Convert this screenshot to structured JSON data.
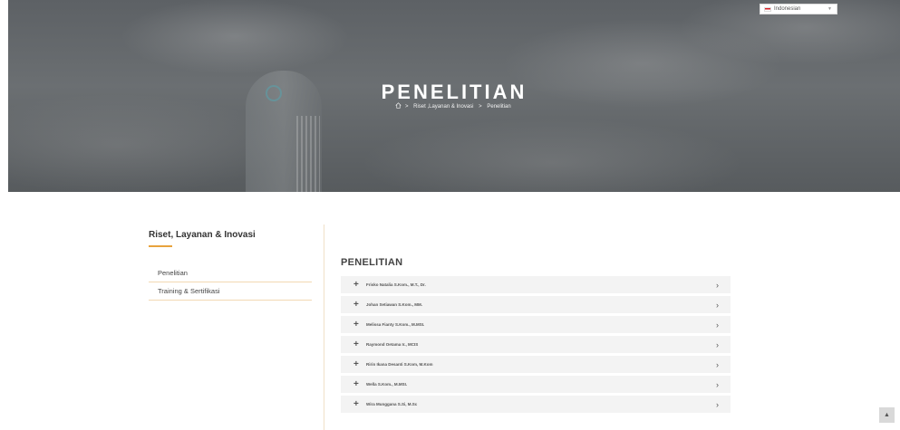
{
  "language": {
    "selected": "Indonesian"
  },
  "hero": {
    "title": "PENELITIAN",
    "breadcrumb": [
      "Riset ,Layanan & Inovasi",
      "Penelitian"
    ],
    "separator": ">"
  },
  "sidebar": {
    "title": "Riset, Layanan & Inovasi",
    "items": [
      "Penelitian",
      "Training & Sertifikasi"
    ]
  },
  "main": {
    "title": "PENELITIAN",
    "items": [
      "Frisko Natalia S.Kom., M.T., Dr.",
      "Johan Setiawan S.Kom., MM.",
      "Melissa Fianty S.Kom., M.MSI.",
      "Raymond Oetama Ir., MCIS",
      "Ririn Ikana Desanti S.Kom, M.Kom",
      "Wella S.Kom., M.MSI.",
      "Wira Munggana S.Si, M.Sc"
    ]
  },
  "colors": {
    "accent": "#e8a33d",
    "row_bg": "#f3f3f3"
  },
  "icons": {
    "home": "home-icon",
    "expand": "plus-icon",
    "row_arrow": "chevron-right-icon",
    "back_top": "chevron-up-icon"
  }
}
